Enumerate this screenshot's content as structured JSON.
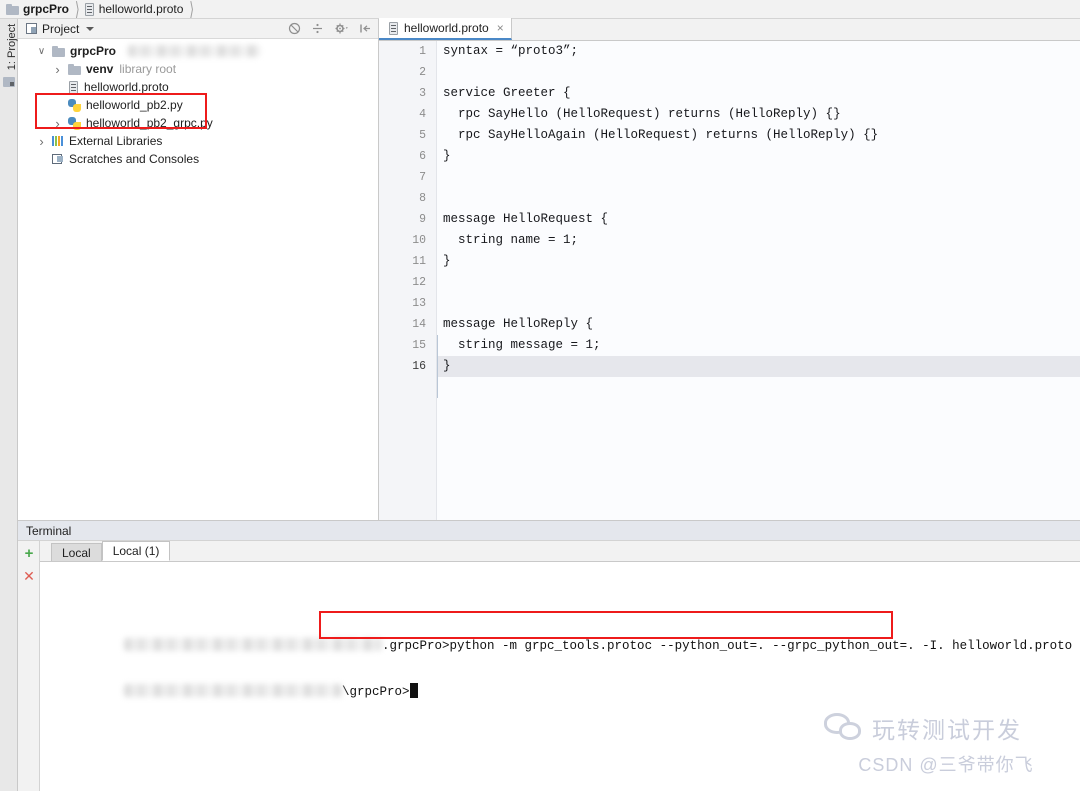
{
  "breadcrumb": {
    "items": [
      {
        "label": "grpcPro",
        "icon": "folder-icon",
        "bold": true
      },
      {
        "label": "helloworld.proto",
        "icon": "proto-file-icon",
        "bold": false
      }
    ]
  },
  "toolstrip": {
    "project_label": "1: Project"
  },
  "project_panel": {
    "title": "Project",
    "header_icons": [
      {
        "name": "hide-empty-middle-packages-icon",
        "glyph": "⊗"
      },
      {
        "name": "collapse-all-icon",
        "glyph": "÷"
      },
      {
        "name": "settings-gear-icon",
        "glyph": "⚙"
      },
      {
        "name": "hide-panel-icon",
        "glyph": "⇥"
      }
    ],
    "tree": [
      {
        "label": "grpcPro",
        "icon": "folder-icon",
        "arrow": "open",
        "indent": 0,
        "bold": true,
        "redacted": true
      },
      {
        "label": "venv",
        "icon": "folder-excluded-icon",
        "arrow": "closed",
        "indent": 1,
        "muted": "library root"
      },
      {
        "label": "helloworld.proto",
        "icon": "proto-file-icon",
        "arrow": "none",
        "indent": 1
      },
      {
        "label": "helloworld_pb2.py",
        "icon": "python-file-icon",
        "arrow": "none",
        "indent": 1
      },
      {
        "label": "helloworld_pb2_grpc.py",
        "icon": "python-file-icon",
        "arrow": "closed",
        "indent": 1
      },
      {
        "label": "External Libraries",
        "icon": "libraries-icon",
        "arrow": "closed",
        "indent": 0
      },
      {
        "label": "Scratches and Consoles",
        "icon": "scratches-icon",
        "arrow": "none",
        "indent": 0
      }
    ]
  },
  "editor": {
    "tab": {
      "label": "helloworld.proto",
      "icon": "proto-file-icon",
      "close": "×"
    },
    "current_line": 16,
    "lines": [
      {
        "n": 1,
        "text": "syntax = “proto3”;"
      },
      {
        "n": 2,
        "text": ""
      },
      {
        "n": 3,
        "text": "service Greeter {"
      },
      {
        "n": 4,
        "text": "  rpc SayHello (HelloRequest) returns (HelloReply) {}"
      },
      {
        "n": 5,
        "text": "  rpc SayHelloAgain (HelloRequest) returns (HelloReply) {}"
      },
      {
        "n": 6,
        "text": "}"
      },
      {
        "n": 7,
        "text": ""
      },
      {
        "n": 8,
        "text": ""
      },
      {
        "n": 9,
        "text": "message HelloRequest {"
      },
      {
        "n": 10,
        "text": "  string name = 1;"
      },
      {
        "n": 11,
        "text": "}"
      },
      {
        "n": 12,
        "text": ""
      },
      {
        "n": 13,
        "text": ""
      },
      {
        "n": 14,
        "text": "message HelloReply {"
      },
      {
        "n": 15,
        "text": "  string message = 1;"
      },
      {
        "n": 16,
        "text": "}"
      }
    ]
  },
  "terminal": {
    "title": "Terminal",
    "add_button": "+",
    "close_button": "✕",
    "tabs": [
      {
        "label": "Local",
        "active": false
      },
      {
        "label": "Local (1)",
        "active": true
      }
    ],
    "lines": [
      {
        "prompt_tail": ".grpcPro>",
        "command": "python -m grpc_tools.protoc --python_out=. --grpc_python_out=. -I. helloworld.proto",
        "redacted_prefix": true
      },
      {
        "prompt_tail": "\\grpcPro>",
        "command": "",
        "redacted_prefix": true,
        "cursor": true
      }
    ]
  },
  "watermark": {
    "icon": "wechat-icon",
    "line1": "玩转测试开发",
    "line2": "CSDN @三爷带你飞"
  },
  "colors": {
    "accent_blue": "#4a88c7",
    "annotation_red": "#ee1b1b",
    "selection_blue": "#a9d2f5",
    "add_green": "#49a84c",
    "close_red": "#de5c52"
  }
}
